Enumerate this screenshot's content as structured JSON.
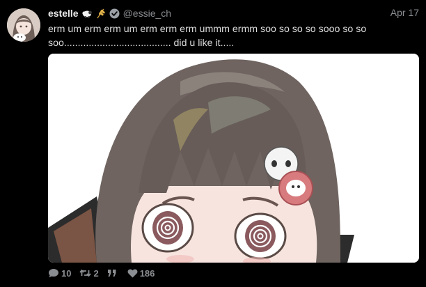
{
  "tweet": {
    "display_name": "estelle",
    "emoji_1": "sheep-emoji",
    "emoji_2": "wheat-emoji",
    "verified": "verified-badge-icon",
    "handle": "@essie_ch",
    "date": "Apr 17",
    "text_line_1": "erm um erm erm um erm erm erm ummm ermm soo so so so sooo so so",
    "text_line_2": "soo....................................... did u like it.....",
    "media_description_icon": "anime-girl-artwork"
  },
  "actions": {
    "replies": "10",
    "retweets": "2",
    "likes": "186",
    "reply_icon": "speech-bubble-icon",
    "retweet_icon": "retweet-icon",
    "quote_icon": "quote-icon",
    "like_icon": "heart-icon"
  },
  "colors": {
    "background": "#000000",
    "text": "#dcdcdc",
    "muted": "#8a8d91",
    "verified": "#8a8d91"
  }
}
